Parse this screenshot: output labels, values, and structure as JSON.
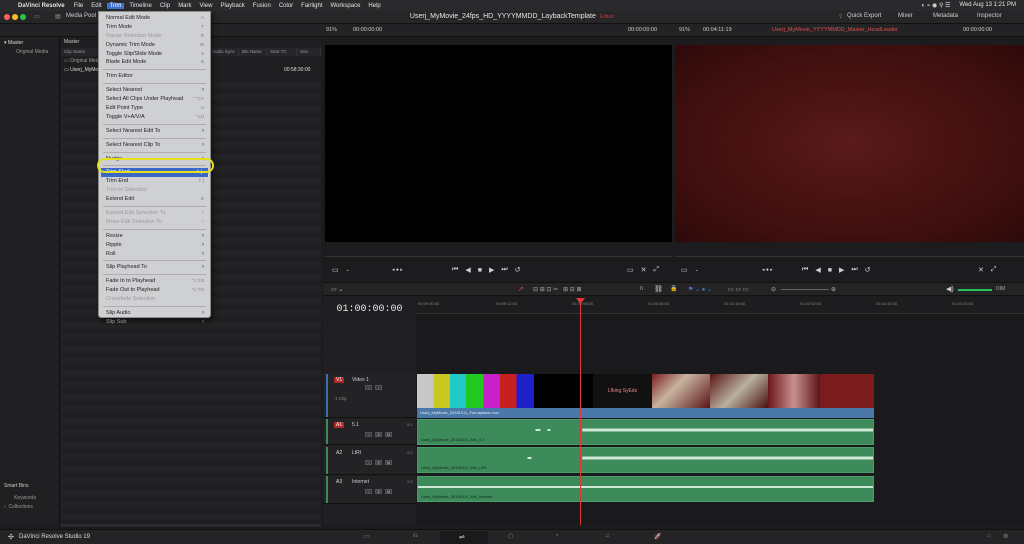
{
  "mac_menubar": {
    "app_name": "DaVinci Resolve",
    "items": [
      "File",
      "Edit",
      "Trim",
      "Timeline",
      "Clip",
      "Mark",
      "View",
      "Playback",
      "Fusion",
      "Color",
      "Fairlight",
      "Workspace",
      "Help"
    ],
    "active_item": "Trim",
    "clock": "Wed Aug 13  1:21 PM"
  },
  "titlebar": {
    "media_pool_label": "Media Pool",
    "project_title": "Userj_MyMovie_24fps_HD_YYYYMMDD_LaybackTemplate",
    "edited_label": "Edited",
    "quick_export": "Quick Export",
    "mixer": "Mixer",
    "metadata": "Metadata",
    "inspector": "Inspector"
  },
  "subbar": {
    "left_zoom": "91%",
    "left_timecode": "00:00:00:00",
    "source_tc": "00:00:00:00",
    "right_zoom": "91%",
    "right_duration": "00:04:11:19",
    "timeline_name": "Userj_MyMovie_YYYYMMDD_Master_HeadLeader",
    "record_tc": "00:00:00:00"
  },
  "left_pane": {
    "master": "Master",
    "original_media": "Original Media",
    "smart_bins": "Smart Bins",
    "keywords": "Keywords",
    "collections": "Collections"
  },
  "media_pool": {
    "header": "Master",
    "columns": [
      "Clip Name",
      "Reel Name",
      "Start TC",
      "End TC",
      "Audio Sync",
      "Bin Name",
      "Start TC",
      "Sou"
    ],
    "rows": [
      {
        "name": "Original Media",
        "tc": ""
      },
      {
        "name": "Userj_MyMovie",
        "tc": "00:58:30:00"
      }
    ]
  },
  "trim_menu": {
    "items": [
      {
        "label": "Normal Edit Mode",
        "shortcut": "A",
        "disabled": false,
        "arrow": false
      },
      {
        "label": "Trim Mode",
        "shortcut": "T",
        "disabled": false,
        "arrow": false
      },
      {
        "label": "Range Selection Mode",
        "shortcut": "R",
        "disabled": true,
        "arrow": false
      },
      {
        "label": "Dynamic Trim Mode",
        "shortcut": "W",
        "disabled": false,
        "arrow": false
      },
      {
        "label": "Toggle Slip/Slide Mode",
        "shortcut": "S",
        "disabled": false,
        "arrow": false
      },
      {
        "label": "Blade Edit Mode",
        "shortcut": "B",
        "disabled": false,
        "arrow": false
      },
      {
        "sep": true
      },
      {
        "label": "Trim Editor",
        "shortcut": "",
        "disabled": false,
        "arrow": false
      },
      {
        "sep": true
      },
      {
        "label": "Select Nearest",
        "shortcut": "",
        "disabled": false,
        "arrow": true
      },
      {
        "label": "Select All Clips Under Playhead",
        "shortcut": "⌃⌥Y",
        "disabled": false,
        "arrow": false
      },
      {
        "label": "Edit Point Type",
        "shortcut": "U",
        "disabled": false,
        "arrow": false
      },
      {
        "label": "Toggle V+A/V/A",
        "shortcut": "⌥U",
        "disabled": false,
        "arrow": false
      },
      {
        "sep": true
      },
      {
        "label": "Select Nearest Edit To",
        "shortcut": "",
        "disabled": false,
        "arrow": true
      },
      {
        "sep": true
      },
      {
        "label": "Select Nearest Clip To",
        "shortcut": "",
        "disabled": false,
        "arrow": true
      },
      {
        "sep": true
      },
      {
        "label": "Nudge",
        "shortcut": "",
        "disabled": false,
        "arrow": true
      },
      {
        "sep": true
      },
      {
        "label": "Trim Start",
        "shortcut": "⇧ [",
        "disabled": false,
        "arrow": false,
        "highlighted": true
      },
      {
        "label": "Trim End",
        "shortcut": "⇧ ]",
        "disabled": false,
        "arrow": false
      },
      {
        "label": "Trim to Selection",
        "shortcut": "",
        "disabled": true,
        "arrow": false
      },
      {
        "label": "Extend Edit",
        "shortcut": "E",
        "disabled": false,
        "arrow": false
      },
      {
        "sep": true
      },
      {
        "label": "Extend Edit Selection To",
        "shortcut": "",
        "disabled": true,
        "arrow": true
      },
      {
        "label": "Move Edit Selection To",
        "shortcut": "",
        "disabled": true,
        "arrow": true
      },
      {
        "sep": true
      },
      {
        "label": "Resize",
        "shortcut": "",
        "disabled": false,
        "arrow": true
      },
      {
        "label": "Ripple",
        "shortcut": "",
        "disabled": false,
        "arrow": true
      },
      {
        "label": "Roll",
        "shortcut": "",
        "disabled": false,
        "arrow": true
      },
      {
        "sep": true
      },
      {
        "label": "Slip Playhead To",
        "shortcut": "",
        "disabled": false,
        "arrow": true
      },
      {
        "sep": true
      },
      {
        "label": "Fade In to Playhead",
        "shortcut": "⌥⇧D",
        "disabled": false,
        "arrow": false
      },
      {
        "label": "Fade Out to Playhead",
        "shortcut": "⌥⇧G",
        "disabled": false,
        "arrow": false
      },
      {
        "label": "Crossfade Selection",
        "shortcut": "",
        "disabled": true,
        "arrow": false
      },
      {
        "sep": true
      },
      {
        "label": "Slip Audio",
        "shortcut": "",
        "disabled": false,
        "arrow": true
      },
      {
        "label": "Slip Sub",
        "shortcut": "",
        "disabled": true,
        "arrow": true
      }
    ]
  },
  "timeline": {
    "timecode": "01:00:00:00",
    "ruler_labels": [
      "00:59:30:00",
      "00:59:12:00",
      "01:00:06:00",
      "01:00:36:00",
      "01:01:18:00",
      "01:02:00:00",
      "01:02:42:00",
      "01:03:24:00"
    ],
    "tracks": {
      "v1": {
        "tag": "V1",
        "name": "Video 1",
        "clips_label": "1 Clip",
        "clip_name": "Userj_MyMovie_20181011_ForLayback.mov"
      },
      "a1": {
        "tag": "A1",
        "name": "5.1",
        "ch": "5.1",
        "clip_name": "Userj_MyMovie_20181011_Mix_5.1"
      },
      "a2": {
        "tag": "A2",
        "name": "LtRt",
        "ch": "2.0",
        "clip_name": "Userj_MyMovie_20181011_Mix_LtRt"
      },
      "a3": {
        "tag": "A3",
        "name": "Internet",
        "ch": "2.0",
        "clip_name": "Userj_MyMovie_20181011_Mix_Internet"
      }
    },
    "thumb_text": "Lfking SyEds"
  },
  "pagebar": {
    "app_label": "DaVinci Resolve Studio 19"
  },
  "colors": {
    "menu_highlight": "#3a68c8",
    "callout_ring": "#e6e01a",
    "playhead": "#e03838",
    "audio_clip": "#3d8a5a",
    "video_clip_label": "#4a78a8",
    "timeline_name": "#e05050"
  }
}
